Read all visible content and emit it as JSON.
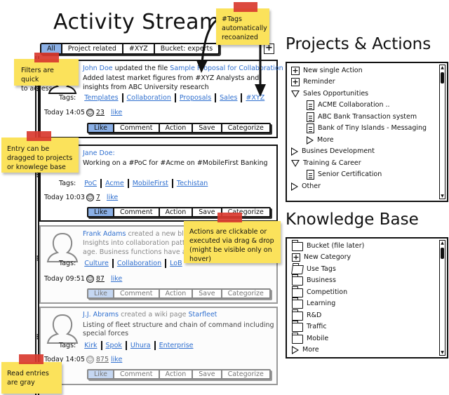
{
  "stream": {
    "title": "Activity Stream",
    "filters": [
      {
        "label": "All",
        "active": true
      },
      {
        "label": "Project related",
        "active": false
      },
      {
        "label": "#XYZ",
        "active": false
      },
      {
        "label": "Bucket: experts",
        "active": false
      }
    ],
    "add_button": "+",
    "entries": [
      {
        "author": "John Doe",
        "verb": " updated the file ",
        "object": "Sample Proposal for Collaboration",
        "body_line1": "Added latest market figures from #XYZ Analysts and",
        "body_line2": "insights from ABC University research",
        "tags_label": "Tags:",
        "tags": [
          "Templates",
          "Collaboration",
          "Proposals",
          "Sales",
          "#XYZ"
        ],
        "time": "Today 14:05",
        "likes": "23",
        "like_link": "like",
        "read": false
      },
      {
        "author": "Jane Doe:",
        "verb": "",
        "object": "",
        "body_line1": "Working on a #PoC for #Acme on #MobileFirst Banking",
        "body_line2": "",
        "tags_label": "Tags:",
        "tags": [
          "PoC",
          "Acme",
          "MobileFirst",
          "Techistan"
        ],
        "time": "Today 10:03",
        "likes": "7",
        "like_link": "like",
        "read": false
      },
      {
        "author": "Frank Adams",
        "verb": " created a new blog",
        "object": "",
        "body_line1": "Insights into collaboration patter",
        "body_line2": "age. Business functions have a b",
        "tags_label": "Tags:",
        "tags": [
          "Culture",
          "Collaboration",
          "LoB"
        ],
        "time": "Today 09:51",
        "likes": "87",
        "like_link": "like",
        "read": true
      },
      {
        "author": "J.J. Abrams",
        "verb": " created a wiki page ",
        "object": "Starfleet",
        "body_line1": "Listing of fleet structure and chain of command including",
        "body_line2": "special forces",
        "tags_label": "Tags:",
        "tags": [
          "Kirk",
          "Spok",
          "Uhura",
          "Enterprise"
        ],
        "time": "Today 14:05",
        "likes": "875",
        "like_link": "like",
        "read": true
      }
    ],
    "actions": [
      "Like",
      "Comment",
      "Action",
      "Save",
      "Categorize"
    ]
  },
  "projects": {
    "title": "Projects & Actions",
    "items": [
      {
        "label": "New single Action",
        "icon": "plus",
        "level": 0
      },
      {
        "label": "Reminder",
        "icon": "plus",
        "level": 0
      },
      {
        "label": "Sales Opportunities",
        "icon": "expanded",
        "level": 0
      },
      {
        "label": "ACME Collaboration ..",
        "icon": "document",
        "level": 1
      },
      {
        "label": "ABC Bank Transaction system",
        "icon": "document",
        "level": 1
      },
      {
        "label": "Bank of Tiny Islands - Messaging",
        "icon": "document",
        "level": 1
      },
      {
        "label": "More",
        "icon": "collapsed",
        "level": 1
      },
      {
        "label": "Busines Development",
        "icon": "collapsed",
        "level": 0
      },
      {
        "label": "Training & Career",
        "icon": "expanded",
        "level": 0
      },
      {
        "label": "Senior Certification",
        "icon": "document",
        "level": 1
      },
      {
        "label": "Other",
        "icon": "collapsed",
        "level": 0
      }
    ]
  },
  "knowledge": {
    "title": "Knowledge Base",
    "items": [
      {
        "label": "Bucket (file later)",
        "icon": "folder"
      },
      {
        "label": "New Category",
        "icon": "plus"
      },
      {
        "label": "Use Tags",
        "icon": "folder-open"
      },
      {
        "label": "Business",
        "icon": "folder"
      },
      {
        "label": "Competition",
        "icon": "folder"
      },
      {
        "label": "Learning",
        "icon": "folder"
      },
      {
        "label": "R&D",
        "icon": "folder"
      },
      {
        "label": "Traffic",
        "icon": "folder"
      },
      {
        "label": "Mobile",
        "icon": "folder"
      },
      {
        "label": "More",
        "icon": "collapsed"
      }
    ]
  },
  "notes": {
    "tags": "#Tags\nautomatically\nrecoanized",
    "filters": "Filters are quick\nto access",
    "drag": "Entry can be\ndragged to projects\nor knowlege base",
    "actions": "Actions are clickable or\nexecuted via drag & drop\n(might be visible only on\nhover)",
    "read": "Read entries\nare gray"
  },
  "colors": {
    "accent": "#8bb0e6",
    "link": "#2f6fcf",
    "sticky": "#fbe25b",
    "tape": "#d93a2f"
  }
}
